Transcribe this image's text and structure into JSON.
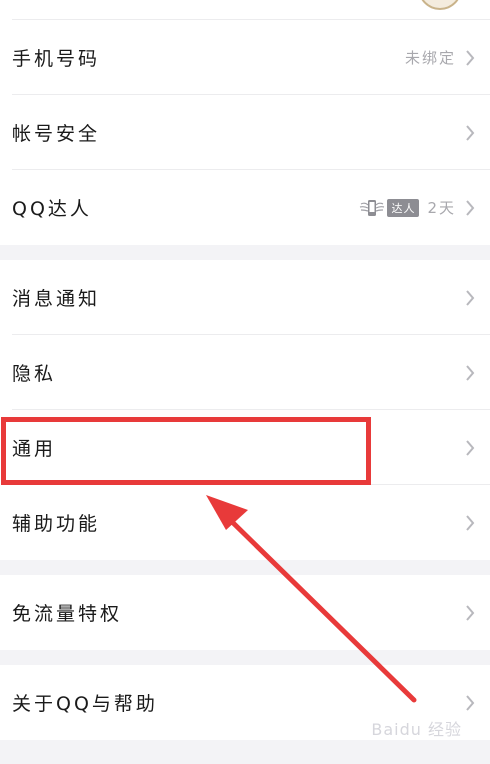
{
  "settings": {
    "phone": {
      "label": "手机号码",
      "value": "未绑定"
    },
    "account_security": {
      "label": "帐号安全"
    },
    "qq_daren": {
      "label": "QQ达人",
      "badge_text": "达人",
      "value": "2天"
    },
    "notifications": {
      "label": "消息通知"
    },
    "privacy": {
      "label": "隐私"
    },
    "general": {
      "label": "通用"
    },
    "accessibility": {
      "label": "辅助功能"
    },
    "free_data": {
      "label": "免流量特权"
    },
    "about": {
      "label": "关于QQ与帮助"
    }
  },
  "watermark": "Baidu 经验",
  "colors": {
    "highlight": "#e83a3a",
    "background": "#f3f3f6",
    "chevron": "#b8b8bd"
  }
}
